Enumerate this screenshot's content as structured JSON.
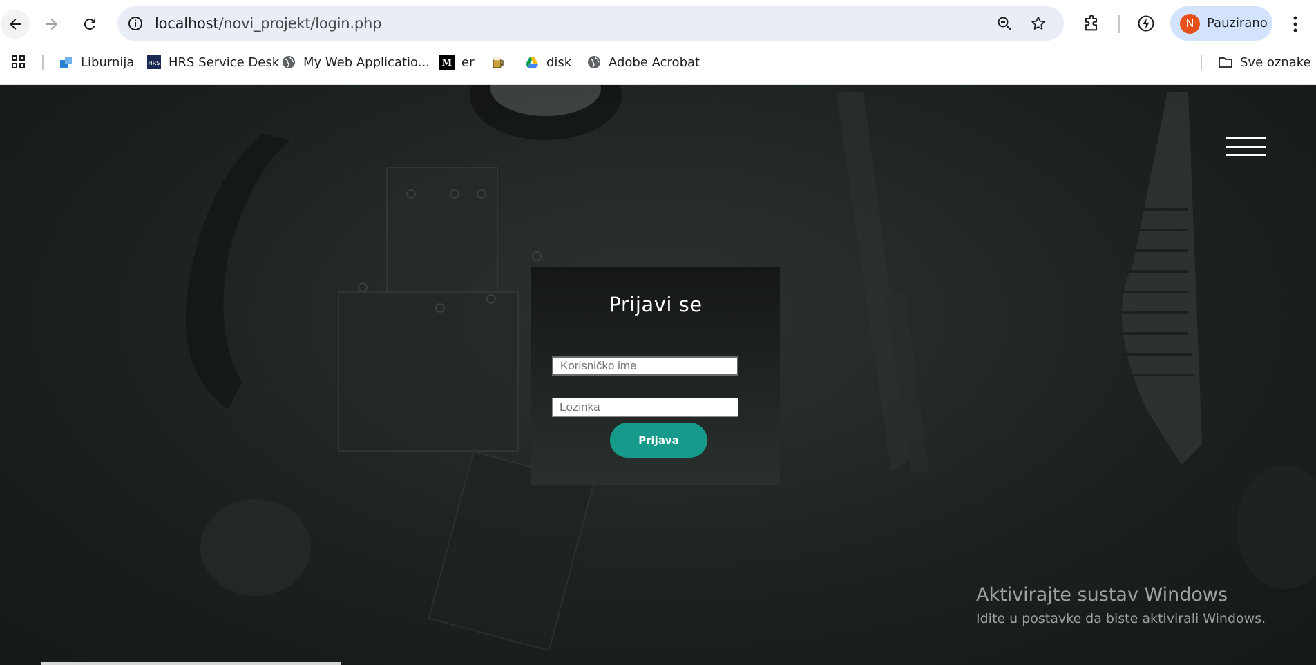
{
  "browser": {
    "url_host": "localhost",
    "url_path": "/novi_projekt/login.php",
    "profile_initial": "N",
    "profile_label": "Pauzirano",
    "bookmarks": [
      {
        "label": "Liburnija",
        "icon": "liburnija-icon"
      },
      {
        "label": "HRS Service Desk",
        "icon": "hrs-icon"
      },
      {
        "label": "My Web Applicatio...",
        "icon": "globe-icon"
      },
      {
        "label": "er",
        "icon": "medium-icon"
      },
      {
        "label": "",
        "icon": "beer-icon"
      },
      {
        "label": "disk",
        "icon": "google-drive-icon"
      },
      {
        "label": "Adobe Acrobat",
        "icon": "globe-icon"
      }
    ],
    "all_bookmarks_label": "Sve oznake"
  },
  "login": {
    "title": "Prijavi se",
    "username_placeholder": "Korisničko ime",
    "password_placeholder": "Lozinka",
    "submit_label": "Prijava"
  },
  "watermark": {
    "title": "Aktivirajte sustav Windows",
    "subtitle": "Idite u postavke da biste aktivirali Windows."
  },
  "colors": {
    "accent": "#159a8c",
    "avatar": "#e8501b",
    "omnibox": "#e9eef6",
    "profile_chip": "#d3e3fd"
  }
}
